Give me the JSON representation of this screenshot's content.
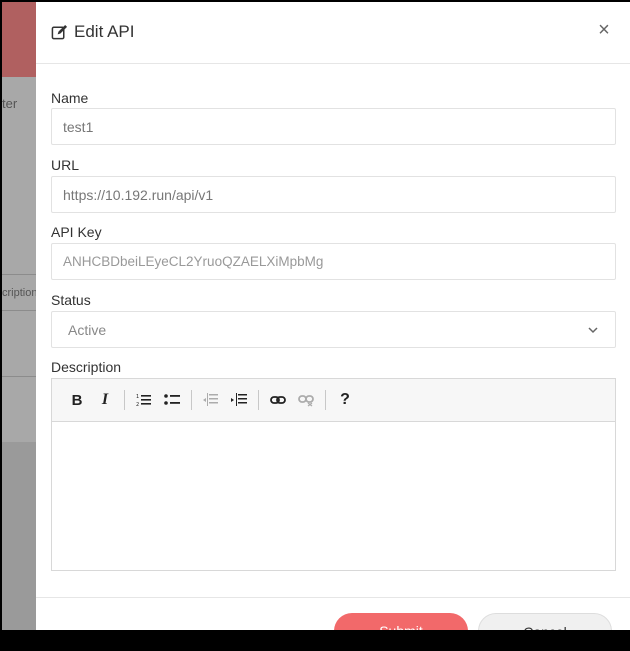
{
  "background": {
    "filter_text": "ter",
    "description_text": "cription"
  },
  "modal": {
    "title": "Edit API",
    "title_icon": "edit-icon",
    "close_label": "×"
  },
  "form": {
    "name": {
      "label": "Name",
      "value": "test1"
    },
    "url": {
      "label": "URL",
      "value": "https://10.192.run/api/v1"
    },
    "api_key": {
      "label": "API Key",
      "value": "ANHCBDbeiLEyeCL2YruoQZAELXiMpbMg"
    },
    "status": {
      "label": "Status",
      "value": "Active"
    },
    "description": {
      "label": "Description",
      "toolbar": [
        {
          "name": "bold",
          "label": "B"
        },
        {
          "name": "italic",
          "label": "I"
        },
        {
          "name": "ordered-list-icon"
        },
        {
          "name": "unordered-list-icon"
        },
        {
          "name": "outdent-icon",
          "disabled": true
        },
        {
          "name": "indent-icon"
        },
        {
          "name": "link-icon"
        },
        {
          "name": "unlink-icon",
          "disabled": true
        },
        {
          "name": "help",
          "label": "?"
        }
      ],
      "value": ""
    }
  },
  "footer": {
    "submit_label": "Submit",
    "cancel_label": "Cancel"
  },
  "colors": {
    "accent": "#f2696a",
    "background_red": "#b06060"
  }
}
